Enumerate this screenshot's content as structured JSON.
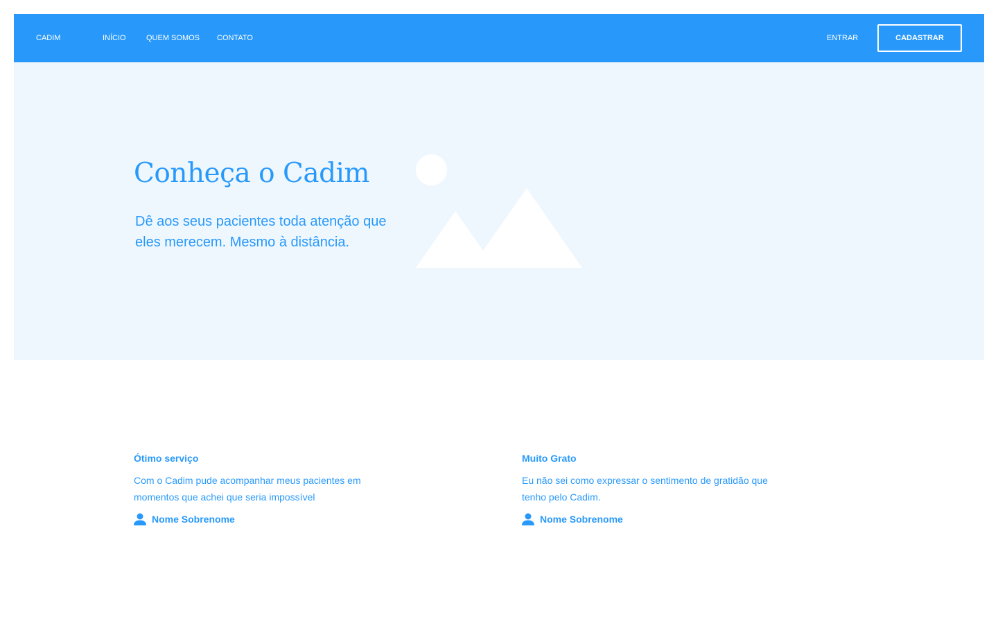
{
  "navbar": {
    "brand": "CADIM",
    "links": [
      "INÍCIO",
      "QUEM SOMOS",
      "CONTATO"
    ],
    "login_label": "ENTRAR",
    "signup_label": "CADASTRAR",
    "background_color": "#2899fb"
  },
  "hero": {
    "title": "Conheça o Cadim",
    "subtitle": "Dê aos seus pacientes toda atenção que eles merecem. Mesmo à distância.",
    "image_icon": "image-placeholder-icon",
    "background_color": "#eff7fe"
  },
  "testimonials": [
    {
      "title": "Ótimo serviço",
      "text": "Com o Cadim pude acompanhar meus pacientes em momentos que achei que seria impossível",
      "author": "Nome Sobrenome",
      "icon": "person-icon"
    },
    {
      "title": "Muito Grato",
      "text": "Eu não sei como expressar o sentimento de gratidão que tenho pelo Cadim.",
      "author": "Nome Sobrenome",
      "icon": "person-icon"
    }
  ],
  "colors": {
    "accent": "#2899fb",
    "white": "#ffffff"
  }
}
